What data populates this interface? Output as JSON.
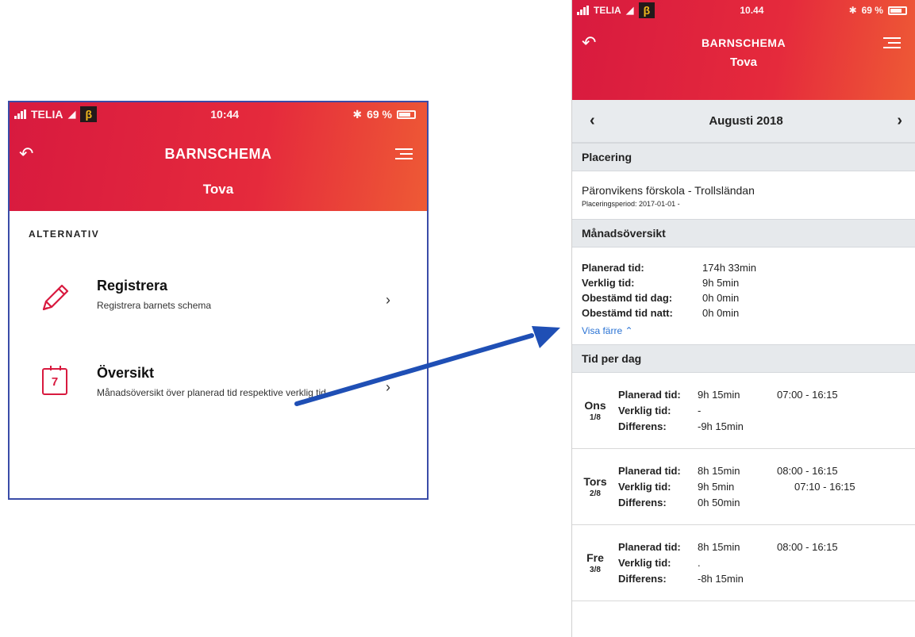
{
  "left": {
    "status": {
      "carrier": "TELIA",
      "beta": "β",
      "time": "10:44",
      "bt": "✱",
      "battery": "69 %"
    },
    "header": {
      "title": "BARNSCHEMA",
      "child": "Tova"
    },
    "alt_label": "ALTERNATIV",
    "options": [
      {
        "title": "Registrera",
        "sub": "Registrera barnets schema"
      },
      {
        "title": "Översikt",
        "sub": "Månadsöversikt över planerad tid respektive verklig tid",
        "cal_day": "7"
      }
    ]
  },
  "right": {
    "status": {
      "carrier": "TELIA",
      "beta": "β",
      "time": "10.44",
      "bt": "✱",
      "battery": "69 %"
    },
    "header": {
      "title": "BARNSCHEMA",
      "child": "Tova"
    },
    "month": "Augusti 2018",
    "placering": {
      "heading": "Placering",
      "name": "Päronvikens förskola - Trollsländan",
      "period": "Placeringsperiod: 2017-01-01 -"
    },
    "monthly": {
      "heading": "Månadsöversikt",
      "rows": [
        {
          "key": "Planerad tid:",
          "val": "174h 33min"
        },
        {
          "key": "Verklig tid:",
          "val": "9h 5min"
        },
        {
          "key": "Obestämd tid dag:",
          "val": "0h 0min"
        },
        {
          "key": "Obestämd tid natt:",
          "val": "0h 0min"
        }
      ],
      "toggle": "Visa färre ⌃"
    },
    "per_day": {
      "heading": "Tid per dag",
      "days": [
        {
          "name": "Ons",
          "date": "1/8",
          "planned": "9h 15min",
          "planned_time": "07:00 - 16:15",
          "actual": "-",
          "actual_time": "",
          "diff": "-9h 15min"
        },
        {
          "name": "Tors",
          "date": "2/8",
          "planned": "8h 15min",
          "planned_time": "08:00 - 16:15",
          "actual": "9h 5min",
          "actual_time": "07:10 - 16:15",
          "diff": "0h 50min"
        },
        {
          "name": "Fre",
          "date": "3/8",
          "planned": "8h 15min",
          "planned_time": "08:00 - 16:15",
          "actual": ".",
          "actual_time": "",
          "diff": "-8h 15min"
        }
      ],
      "labels": {
        "planned": "Planerad tid:",
        "actual": "Verklig tid:",
        "diff": "Differens:"
      }
    }
  },
  "colors": {
    "brand": "#d81a3f",
    "link": "#2a73d4",
    "arrow": "#1f4fb5"
  }
}
